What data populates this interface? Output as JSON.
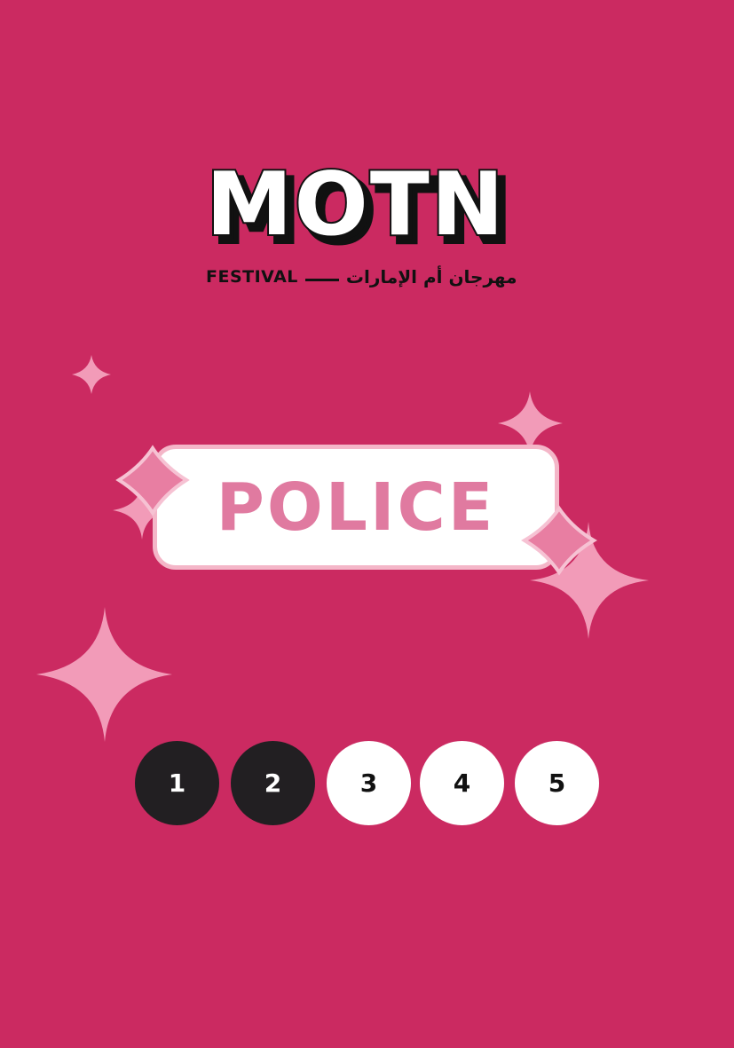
{
  "logo": {
    "text": "MOTN",
    "subtitle_en": "FESTIVAL",
    "subtitle_ar": "مهرجان أم الإمارات"
  },
  "card": {
    "title": "POLICE"
  },
  "rating": {
    "levels": [
      "1",
      "2",
      "3",
      "4",
      "5"
    ],
    "selected_count": 2,
    "max": 5
  },
  "colors": {
    "background": "#cb2a61",
    "card_text": "#e07aa0",
    "card_border": "#f4b6c8",
    "sparkle": "#f29bb8",
    "level_filled": "#221f22",
    "level_empty": "#ffffff"
  },
  "icons": [
    "sparkle-icon",
    "diamond-icon"
  ]
}
